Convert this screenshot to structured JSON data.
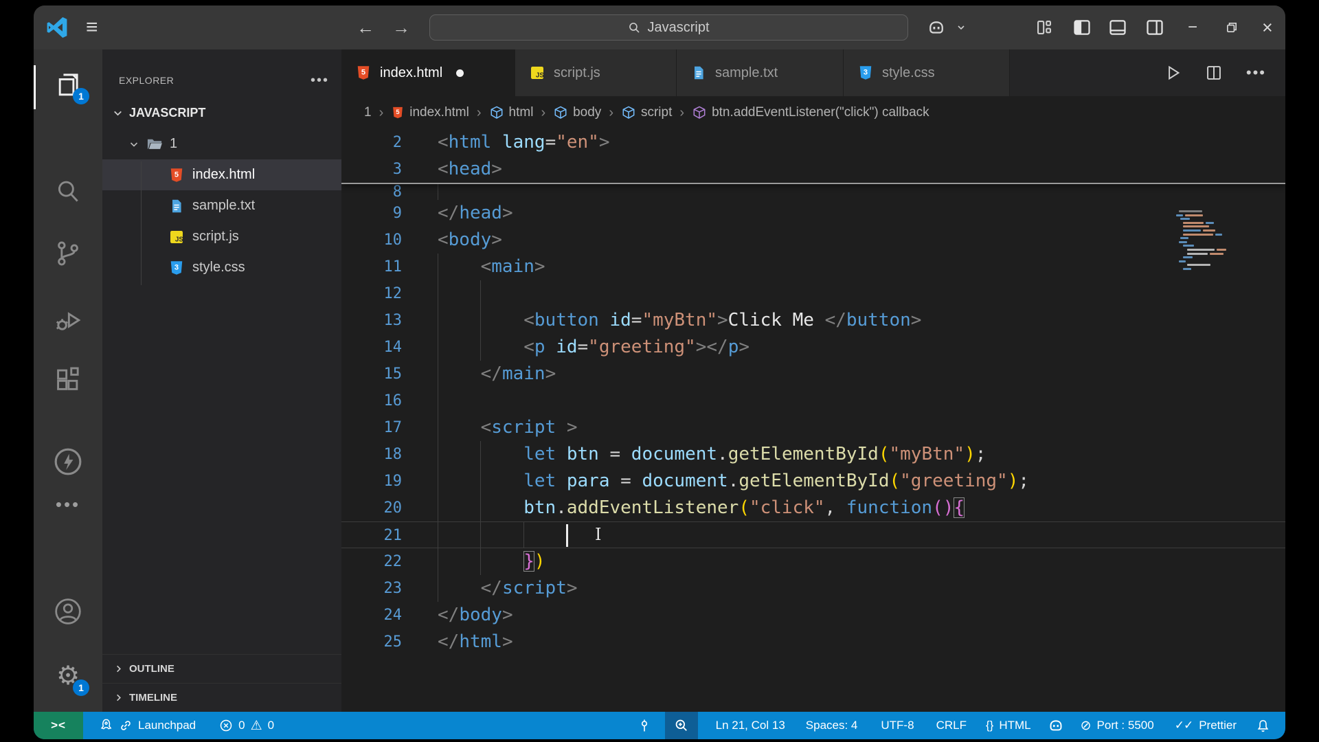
{
  "titlebar": {
    "search_value": "Javascript"
  },
  "tabs": [
    {
      "label": "index.html",
      "icon": "html",
      "active": true,
      "modified": true
    },
    {
      "label": "script.js",
      "icon": "js",
      "active": false,
      "modified": false
    },
    {
      "label": "sample.txt",
      "icon": "txt",
      "active": false,
      "modified": false
    },
    {
      "label": "style.css",
      "icon": "css",
      "active": false,
      "modified": false
    }
  ],
  "breadcrumb": [
    {
      "label": "1",
      "icon": "none"
    },
    {
      "label": "index.html",
      "icon": "html"
    },
    {
      "label": "html",
      "icon": "cube-blue"
    },
    {
      "label": "body",
      "icon": "cube-blue"
    },
    {
      "label": "script",
      "icon": "cube-blue"
    },
    {
      "label": "btn.addEventListener(\"click\") callback",
      "icon": "cube-purple"
    }
  ],
  "explorer": {
    "header": "EXPLORER",
    "workspace": "JAVASCRIPT",
    "folder": "1",
    "files": [
      {
        "name": "index.html",
        "icon": "html",
        "selected": true
      },
      {
        "name": "sample.txt",
        "icon": "txt",
        "selected": false
      },
      {
        "name": "script.js",
        "icon": "js",
        "selected": false
      },
      {
        "name": "style.css",
        "icon": "css",
        "selected": false
      }
    ],
    "bottom_sections": [
      "OUTLINE",
      "TIMELINE"
    ]
  },
  "activity_bar": {
    "explorer_badge": "1",
    "settings_badge": "1",
    "items": [
      "explorer",
      "search",
      "source-control",
      "run-debug",
      "extensions",
      "live-server",
      "more",
      "account",
      "settings"
    ]
  },
  "code": {
    "cursor": {
      "line": 21,
      "col": 13
    },
    "sticky": [
      {
        "n": "2",
        "seg": [
          [
            "<",
            "pn"
          ],
          [
            "html",
            "tg"
          ],
          [
            " ",
            "df"
          ],
          [
            "lang",
            "at"
          ],
          [
            "=",
            "df"
          ],
          [
            "\"en\"",
            "st"
          ],
          [
            ">",
            "pn"
          ]
        ],
        "g": []
      },
      {
        "n": "3",
        "seg": [
          [
            "<",
            "pn"
          ],
          [
            "head",
            "tg"
          ],
          [
            ">",
            "pn"
          ]
        ],
        "g": []
      }
    ],
    "lines": [
      {
        "n": "8",
        "seg": [],
        "g": [
          0
        ],
        "partial": true
      },
      {
        "n": "9",
        "seg": [
          [
            "</",
            "pn"
          ],
          [
            "head",
            "tg"
          ],
          [
            ">",
            "pn"
          ]
        ],
        "g": []
      },
      {
        "n": "10",
        "seg": [
          [
            "<",
            "pn"
          ],
          [
            "body",
            "tg"
          ],
          [
            ">",
            "pn"
          ]
        ],
        "g": []
      },
      {
        "n": "11",
        "seg": [
          [
            "    ",
            "df"
          ],
          [
            "<",
            "pn"
          ],
          [
            "main",
            "tg"
          ],
          [
            ">",
            "pn"
          ]
        ],
        "g": [
          0
        ]
      },
      {
        "n": "12",
        "seg": [],
        "g": [
          0,
          4
        ]
      },
      {
        "n": "13",
        "seg": [
          [
            "        ",
            "df"
          ],
          [
            "<",
            "pn"
          ],
          [
            "button",
            "tg"
          ],
          [
            " ",
            "df"
          ],
          [
            "id",
            "at"
          ],
          [
            "=",
            "df"
          ],
          [
            "\"myBtn\"",
            "st"
          ],
          [
            ">",
            "pn"
          ],
          [
            "Click Me ",
            "tx"
          ],
          [
            "</",
            "pn"
          ],
          [
            "button",
            "tg"
          ],
          [
            ">",
            "pn"
          ]
        ],
        "g": [
          0,
          4
        ]
      },
      {
        "n": "14",
        "seg": [
          [
            "        ",
            "df"
          ],
          [
            "<",
            "pn"
          ],
          [
            "p",
            "tg"
          ],
          [
            " ",
            "df"
          ],
          [
            "id",
            "at"
          ],
          [
            "=",
            "df"
          ],
          [
            "\"greeting\"",
            "st"
          ],
          [
            ">",
            "pn"
          ],
          [
            "</",
            "pn"
          ],
          [
            "p",
            "tg"
          ],
          [
            ">",
            "pn"
          ]
        ],
        "g": [
          0,
          4
        ]
      },
      {
        "n": "15",
        "seg": [
          [
            "    ",
            "df"
          ],
          [
            "</",
            "pn"
          ],
          [
            "main",
            "tg"
          ],
          [
            ">",
            "pn"
          ]
        ],
        "g": [
          0
        ]
      },
      {
        "n": "16",
        "seg": [],
        "g": [
          0
        ]
      },
      {
        "n": "17",
        "seg": [
          [
            "    ",
            "df"
          ],
          [
            "<",
            "pn"
          ],
          [
            "script",
            "tg"
          ],
          [
            " ",
            "df"
          ],
          [
            ">",
            "pn"
          ]
        ],
        "g": [
          0
        ]
      },
      {
        "n": "18",
        "seg": [
          [
            "        ",
            "df"
          ],
          [
            "let",
            "kw"
          ],
          [
            " ",
            "df"
          ],
          [
            "btn",
            "vr"
          ],
          [
            " = ",
            "df"
          ],
          [
            "document",
            "vr"
          ],
          [
            ".",
            "df"
          ],
          [
            "getElementById",
            "fn"
          ],
          [
            "(",
            "b1"
          ],
          [
            "\"myBtn\"",
            "st"
          ],
          [
            ")",
            "b1"
          ],
          [
            ";",
            "df"
          ]
        ],
        "g": [
          0,
          4
        ]
      },
      {
        "n": "19",
        "seg": [
          [
            "        ",
            "df"
          ],
          [
            "let",
            "kw"
          ],
          [
            " ",
            "df"
          ],
          [
            "para",
            "vr"
          ],
          [
            " = ",
            "df"
          ],
          [
            "document",
            "vr"
          ],
          [
            ".",
            "df"
          ],
          [
            "getElementById",
            "fn"
          ],
          [
            "(",
            "b1"
          ],
          [
            "\"greeting\"",
            "st"
          ],
          [
            ")",
            "b1"
          ],
          [
            ";",
            "df"
          ]
        ],
        "g": [
          0,
          4
        ]
      },
      {
        "n": "20",
        "seg": [
          [
            "        ",
            "df"
          ],
          [
            "btn",
            "vr"
          ],
          [
            ".",
            "df"
          ],
          [
            "addEventListener",
            "fn"
          ],
          [
            "(",
            "b1"
          ],
          [
            "\"click\"",
            "st"
          ],
          [
            ", ",
            "df"
          ],
          [
            "function",
            "kw"
          ],
          [
            "(",
            "b2"
          ],
          [
            ")",
            "b2"
          ],
          [
            "{",
            "bm"
          ]
        ],
        "g": [
          0,
          4
        ]
      },
      {
        "n": "21",
        "seg": [],
        "g": [
          0,
          4,
          8
        ],
        "cur": true
      },
      {
        "n": "22",
        "seg": [
          [
            "        ",
            "df"
          ],
          [
            "}",
            "bm"
          ],
          [
            ")",
            "b1"
          ]
        ],
        "g": [
          0,
          4
        ]
      },
      {
        "n": "23",
        "seg": [
          [
            "    ",
            "df"
          ],
          [
            "</",
            "pn"
          ],
          [
            "script",
            "tg"
          ],
          [
            ">",
            "pn"
          ]
        ],
        "g": [
          0
        ]
      },
      {
        "n": "24",
        "seg": [
          [
            "</",
            "pn"
          ],
          [
            "body",
            "tg"
          ],
          [
            ">",
            "pn"
          ]
        ],
        "g": []
      },
      {
        "n": "25",
        "seg": [
          [
            "</",
            "pn"
          ],
          [
            "html",
            "tg"
          ],
          [
            ">",
            "pn"
          ]
        ],
        "g": []
      }
    ]
  },
  "minimap_rows": [
    {
      "m": 4,
      "s": [
        [
          34,
          "g"
        ]
      ]
    },
    {
      "m": 0,
      "s": [
        [
          10,
          "b"
        ],
        [
          26,
          "o"
        ]
      ]
    },
    {
      "m": 6,
      "s": [
        [
          14,
          "b"
        ]
      ]
    },
    {
      "m": 10,
      "s": [
        [
          30,
          "o"
        ],
        [
          12,
          "b"
        ]
      ]
    },
    {
      "m": 10,
      "s": [
        [
          38,
          "o"
        ]
      ]
    },
    {
      "m": 10,
      "s": [
        [
          26,
          "b"
        ],
        [
          18,
          "o"
        ]
      ]
    },
    {
      "m": 10,
      "s": [
        [
          44,
          "o"
        ],
        [
          10,
          "b"
        ]
      ]
    },
    {
      "m": 6,
      "s": [
        [
          12,
          "b"
        ]
      ]
    },
    {
      "m": 4,
      "s": [
        [
          12,
          "b"
        ]
      ]
    },
    {
      "m": 10,
      "s": [
        [
          16,
          "b"
        ]
      ]
    },
    {
      "m": 16,
      "s": [
        [
          40,
          "w"
        ],
        [
          14,
          "o"
        ]
      ]
    },
    {
      "m": 16,
      "s": [
        [
          30,
          "w"
        ],
        [
          20,
          "o"
        ]
      ]
    },
    {
      "m": 10,
      "s": [
        [
          14,
          "b"
        ]
      ]
    },
    {
      "m": 4,
      "s": [
        [
          10,
          "b"
        ]
      ]
    },
    {
      "m": 16,
      "s": [
        [
          34,
          "w"
        ]
      ]
    },
    {
      "m": 10,
      "s": [
        [
          12,
          "b"
        ]
      ]
    }
  ],
  "status_bar": {
    "launchpad": "Launchpad",
    "errors": "0",
    "warnings": "0",
    "cursor_position": "Ln 21, Col 13",
    "indentation": "Spaces: 4",
    "encoding": "UTF-8",
    "eol": "CRLF",
    "lang_braces": "{}",
    "language": "HTML",
    "port": "Port : 5500",
    "formatter": "Prettier"
  },
  "colors": {
    "status_bar": "#0886d0",
    "remote": "#16825d",
    "badge": "#0078d4",
    "html_icon": "#e44d26",
    "css_icon": "#2a9ded",
    "js_icon": "#efd81d",
    "txt_icon": "#4da4e0"
  }
}
